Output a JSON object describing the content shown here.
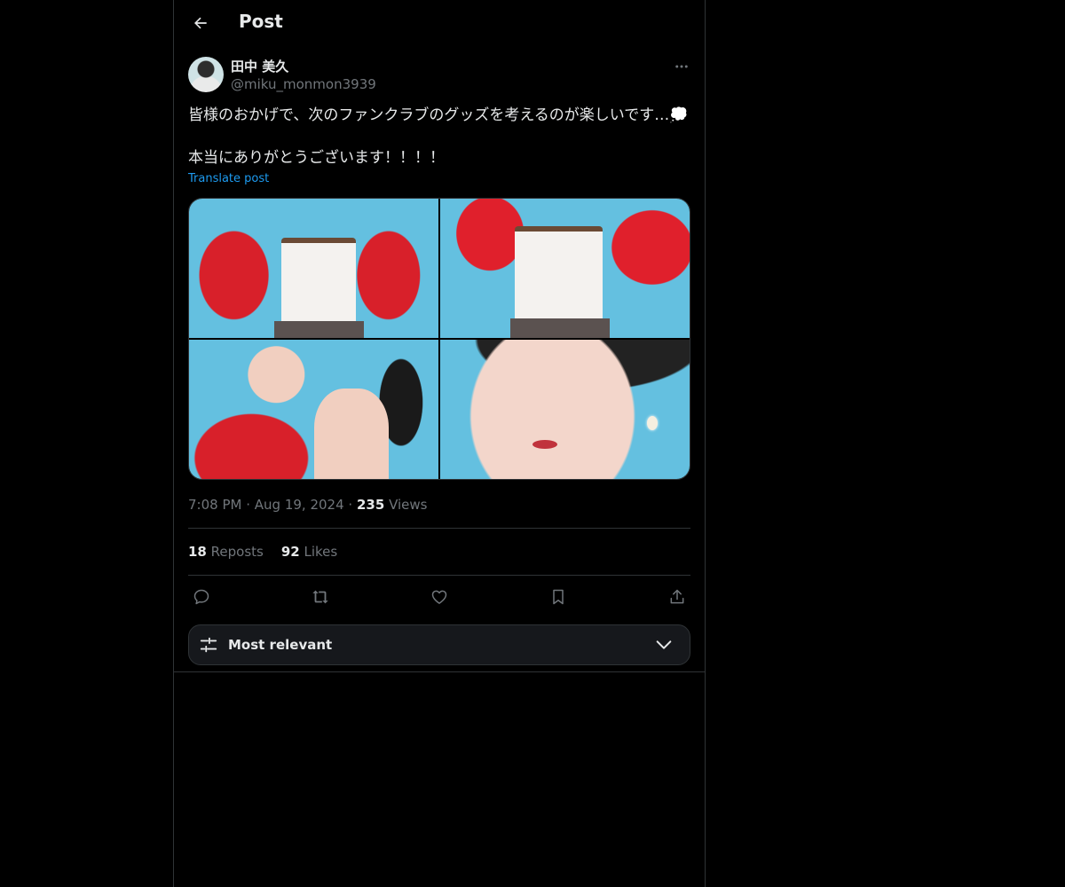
{
  "header": {
    "title": "Post",
    "back_icon": "arrow-left-icon"
  },
  "post": {
    "author": {
      "name": "田中 美久",
      "handle": "@miku_monmon3939"
    },
    "text_line1": "皆様のおかげで、次のファンクラブのグッズを考えるのが楽しいです…💭",
    "text_line2": "本当にありがとうございます！！！！",
    "translate_label": "Translate post",
    "media_count": 4,
    "time": "7:08 PM",
    "date": "Aug 19, 2024",
    "views_count": "235",
    "views_label": "Views",
    "reposts_count": "18",
    "reposts_label": "Reposts",
    "likes_count": "92",
    "likes_label": "Likes"
  },
  "actions": [
    "reply-icon",
    "repost-icon",
    "like-icon",
    "bookmark-icon",
    "share-icon"
  ],
  "sort": {
    "label": "Most relevant"
  },
  "colors": {
    "background": "#000000",
    "text": "#e7e9ea",
    "muted": "#71767b",
    "link": "#1d9bf0",
    "border": "#2f3336"
  }
}
